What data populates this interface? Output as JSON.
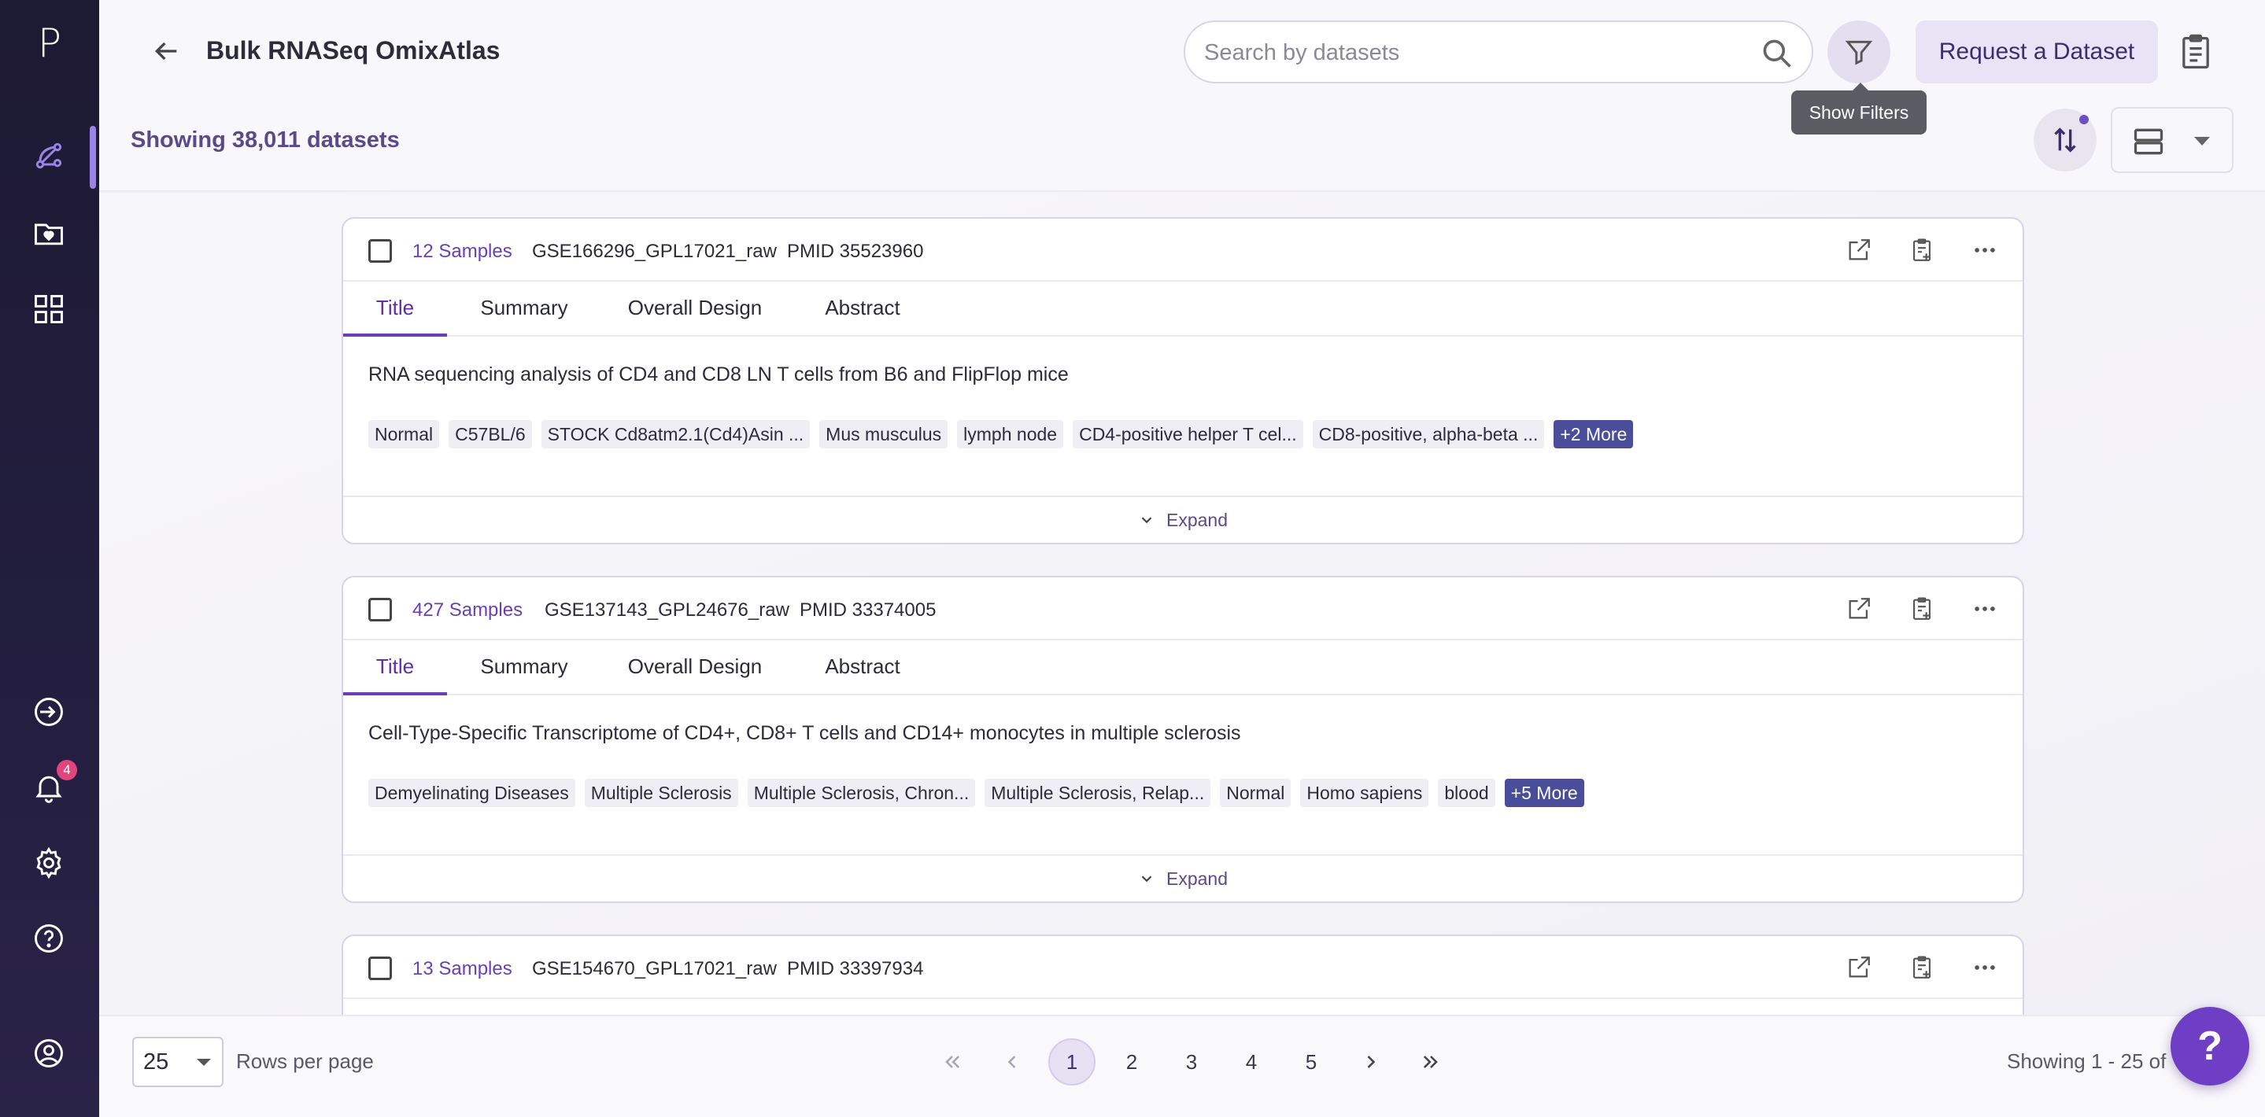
{
  "sidebar": {
    "logo": "P",
    "notification_count": "4",
    "items": [
      {
        "icon": "workflow-icon",
        "active": true
      },
      {
        "icon": "folder-heart-icon"
      },
      {
        "icon": "grid-icon"
      },
      {
        "icon": "import-icon"
      },
      {
        "icon": "bell-icon"
      },
      {
        "icon": "gear-icon"
      },
      {
        "icon": "help-circle-icon"
      },
      {
        "icon": "user-circle-icon"
      }
    ]
  },
  "header": {
    "title": "Bulk RNASeq OmixAtlas",
    "search_placeholder": "Search by datasets",
    "filter_tooltip": "Show Filters",
    "request_button": "Request a Dataset",
    "showing_text": "Showing 38,011 datasets"
  },
  "tabs": [
    "Title",
    "Summary",
    "Overall Design",
    "Abstract"
  ],
  "cards": [
    {
      "samples": "12 Samples",
      "dataset_id": "GSE166296_GPL17021_raw",
      "pmid": "PMID 35523960",
      "title": "RNA sequencing analysis of CD4 and CD8 LN T cells from B6 and FlipFlop mice",
      "tags": [
        "Normal",
        "C57BL/6",
        "STOCK Cd8atm2.1(Cd4)Asin ...",
        "Mus musculus",
        "lymph node",
        "CD4-positive helper T cel...",
        "CD8-positive, alpha-beta ..."
      ],
      "more": "+2 More",
      "expand": "Expand"
    },
    {
      "samples": "427 Samples",
      "dataset_id": "GSE137143_GPL24676_raw",
      "pmid": "PMID 33374005",
      "title": "Cell-Type-Specific Transcriptome of CD4+, CD8+ T cells and CD14+ monocytes in multiple sclerosis",
      "tags": [
        "Demyelinating Diseases",
        "Multiple Sclerosis",
        "Multiple Sclerosis, Chron...",
        "Multiple Sclerosis, Relap...",
        "Normal",
        "Homo sapiens",
        "blood"
      ],
      "more": "+5 More",
      "expand": "Expand"
    },
    {
      "samples": "13 Samples",
      "dataset_id": "GSE154670_GPL17021_raw",
      "pmid": "PMID 33397934"
    }
  ],
  "footer": {
    "rows_value": "25",
    "rows_label": "Rows per page",
    "pages": [
      "1",
      "2",
      "3",
      "4",
      "5"
    ],
    "active_page": "1",
    "showing_range": "Showing 1 - 25 of"
  },
  "help_label": "?",
  "colors": {
    "accent": "#6a3fb6",
    "sidebar_bg": "#1d1a33",
    "more_tag": "#4a4e9a",
    "badge": "#e0457b"
  }
}
